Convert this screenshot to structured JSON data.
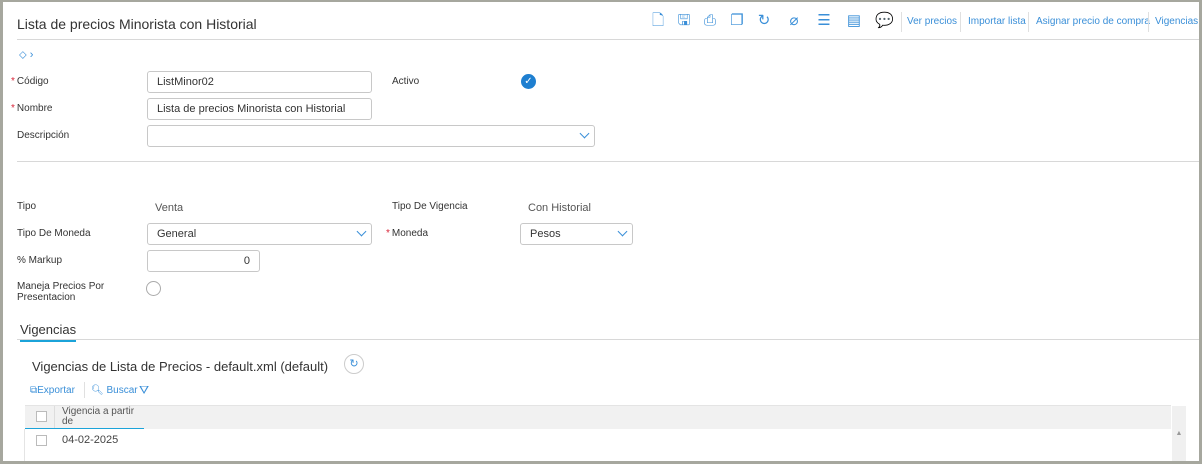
{
  "header": {
    "title": "Lista de precios Minorista con Historial"
  },
  "toolbar": {
    "icons": [
      "new-document-icon",
      "save-icon",
      "print-icon",
      "copy-icon",
      "history-icon",
      "attach-icon",
      "checklist-icon",
      "report-icon",
      "comment-icon"
    ],
    "links": [
      "Ver precios",
      "Importar lista",
      "Asignar precio de compra",
      "Vigencias"
    ]
  },
  "form": {
    "codigo_label": "Código",
    "codigo_value": "ListMinor02",
    "activo_label": "Activo",
    "activo_checked": true,
    "nombre_label": "Nombre",
    "nombre_value": "Lista de precios Minorista con Historial",
    "descripcion_label": "Descripción",
    "descripcion_value": "",
    "tipo_label": "Tipo",
    "tipo_value": "Venta",
    "tipo_vigencia_label": "Tipo De Vigencia",
    "tipo_vigencia_value": "Con Historial",
    "tipo_moneda_label": "Tipo De Moneda",
    "tipo_moneda_value": "General",
    "moneda_label": "Moneda",
    "moneda_value": "Pesos",
    "markup_label": "% Markup",
    "markup_value": "0",
    "maneja_label": "Maneja Precios Por Presentacion",
    "maneja_checked": false
  },
  "tabs": [
    {
      "label": "Vigencias",
      "active": true
    }
  ],
  "grid": {
    "title": "Vigencias de Lista de Precios - default.xml (default)",
    "export_label": "Exportar",
    "search_label": "Buscar",
    "columns": [
      "Vigencia a partir de"
    ],
    "rows": [
      [
        "04-02-2025"
      ]
    ]
  },
  "colors": {
    "accent": "#3a8fd8",
    "tab_underline": "#1ba3d9",
    "required": "#d9263a"
  }
}
